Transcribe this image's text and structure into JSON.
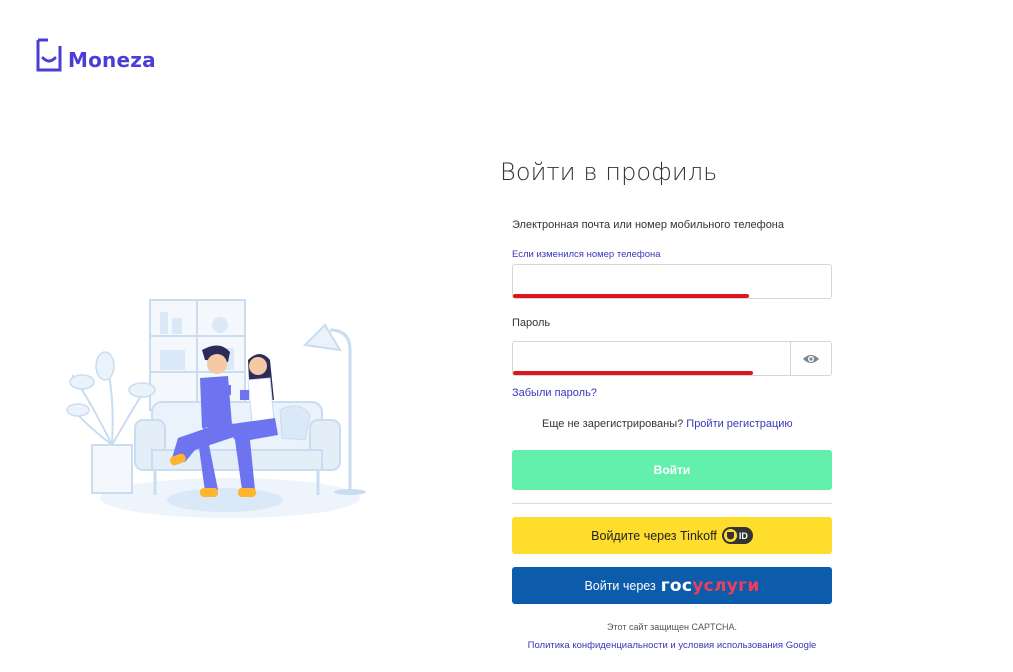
{
  "brand": {
    "name": "Moneza",
    "color": "#4b3ed6"
  },
  "illustration": {
    "icon": "couple-on-sofa-illustration"
  },
  "form": {
    "title": "Войти в профиль",
    "login_label": "Электронная почта или номер мобильного телефона",
    "phone_changed_link": "Если изменился номер телефона",
    "login_value": "",
    "password_label": "Пароль",
    "password_value": "",
    "show_password_icon": "eye-icon",
    "forgot_link": "Забыли пароль?",
    "register_prompt": "Еще не зарегистрированы? ",
    "register_link": "Пройти регистрацию",
    "login_button": "Войти",
    "tinkoff_button": "Войдите через Tinkoff",
    "tinkoff_badge": "ID",
    "gos_button_prefix": "Войти через",
    "gos_logo_part1": "гос",
    "gos_logo_part2": "услуги",
    "captcha_text": "Этот сайт защищен CAPTCHA.",
    "policy_link": "Политика конфиденциальности и условия использования Google"
  },
  "colors": {
    "login_button": "#62f0ac",
    "tinkoff": "#ffdd2d",
    "gosuslugi": "#0d5bab",
    "link": "#3a36b8",
    "redaction": "#e0151b"
  }
}
